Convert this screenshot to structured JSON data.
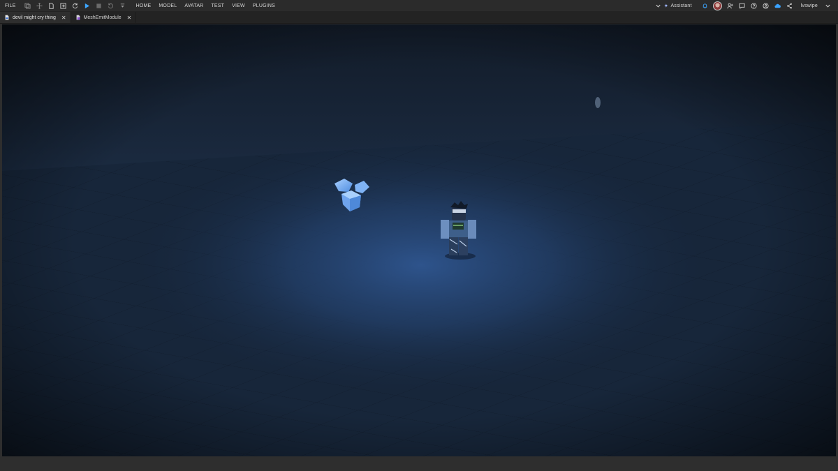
{
  "menubar": {
    "file_label": "FILE",
    "items": [
      "HOME",
      "MODEL",
      "AVATAR",
      "TEST",
      "VIEW",
      "PLUGINS"
    ],
    "assistant_label": "Assistant",
    "username": "lvswipe"
  },
  "tabs": [
    {
      "label": "devil might cry thing",
      "icon": "place-icon"
    },
    {
      "label": "MeshEmitModule",
      "icon": "module-script-icon"
    }
  ],
  "colors": {
    "play_accent": "#3da6ff",
    "cloud_accent": "#3aa3ff",
    "viewport_floor": "#1f3554",
    "viewport_sky": "#223a58",
    "crystal": "#7fb3f5"
  }
}
